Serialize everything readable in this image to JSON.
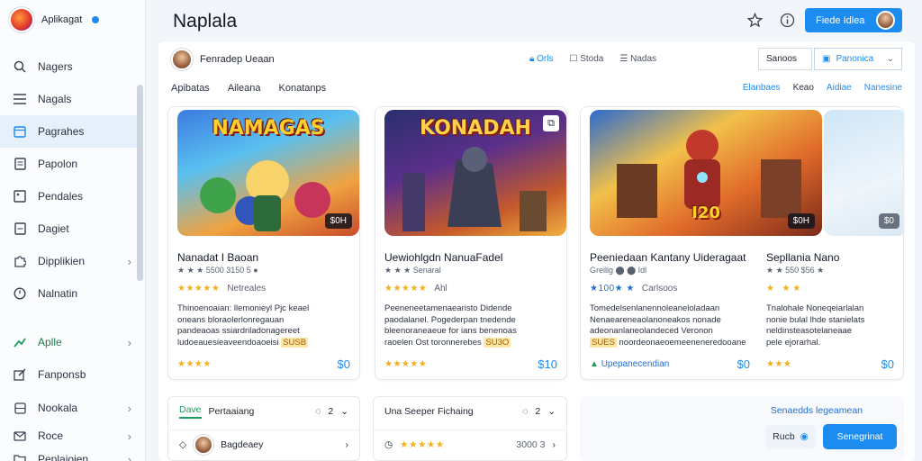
{
  "app": {
    "name": "Aplikagat",
    "title": "Naplala"
  },
  "sidebar": {
    "items": [
      {
        "label": "Nagers",
        "icon": "search-icon"
      },
      {
        "label": "Nagals",
        "icon": "list-icon"
      },
      {
        "label": "Pagrahes",
        "icon": "calendar-icon",
        "active": true
      },
      {
        "label": "Papolon",
        "icon": "document-icon"
      },
      {
        "label": "Pendales",
        "icon": "image-icon"
      },
      {
        "label": "Dagiet",
        "icon": "file-icon"
      },
      {
        "label": "Dipplikien",
        "icon": "puzzle-icon",
        "chevron": true
      },
      {
        "label": "Nalnatin",
        "icon": "clock-icon"
      },
      {
        "label": "Aplle",
        "icon": "trend-icon",
        "chevron": true,
        "accent": true
      },
      {
        "label": "Fanponsb",
        "icon": "edit-icon"
      },
      {
        "label": "Nookala",
        "icon": "grid-icon",
        "chevron": true
      },
      {
        "label": "Roce",
        "icon": "mail-icon",
        "chevron": true
      },
      {
        "label": "Peplaiojen",
        "icon": "folder-icon",
        "chevron": true
      }
    ]
  },
  "header": {
    "action_label": "Fiede Idlea"
  },
  "user": {
    "name": "Fenradep Ueaan"
  },
  "top_tabs": [
    "Orls",
    "Stoda",
    "Nadas"
  ],
  "selects": {
    "left": "Sanoos",
    "right": "Panonica"
  },
  "filters": [
    "Apibatas",
    "Aileana",
    "Konatanps"
  ],
  "sort_options": [
    "Elanbaes",
    "Keao",
    "Aidiae",
    "Nanesine"
  ],
  "cards": [
    {
      "thumb_title": "NAMAGAS",
      "price_chip": "$0H",
      "title": "Nanadat I Baoan",
      "meta": "★ ★ ★ 5500 3150 5 ●",
      "rating_note": "Netreales",
      "desc_lines": [
        "Thinoenoaian: llemonieyl Pjc keael",
        "oneans bloraolerlonregauan",
        "pandeaoas  ssiardriladonagereet",
        "ludoeauesieaveendoaoeisi"
      ],
      "desc_highlight": "SUSB",
      "foot_left": "",
      "price": "$0",
      "stars": "★★★★★",
      "foot_stars": "★★★★"
    },
    {
      "thumb_title": "KONADAH",
      "price_chip": "",
      "title": "Uewiohlgdn NanuaFadel",
      "meta": "★ ★ ★ Senaral",
      "rating_note": "Ahl",
      "desc_lines": [
        "Peeneneetamenaearisto Didende",
        "paodalanel. Pogederpan tnedende",
        "bleenoraneaeue  for ians benenoas",
        "raoelen Ost toronnerebes"
      ],
      "desc_highlight": "SU3O",
      "foot_left": "",
      "price": "$10",
      "stars": "★★★★★",
      "foot_stars": "★★★★★"
    },
    {
      "thumb_title": "I20",
      "price_chip": "$0H",
      "title": "Peeniedaan Kantany Uideragaat",
      "meta": "Greilig ⬤ ⬤ Idl",
      "rating_note": "Carlsoos",
      "desc_lines": [
        "Tomedelsenlanennoleaneloladaan",
        "Nenaeareneaolanoneakos nonade",
        "adeonanlaneolandeced Veronon",
        "noordeonaeoemeeneneredooane"
      ],
      "desc_highlight": "SUES",
      "foot_left": "Upepanecendian",
      "price": "$0",
      "stars": "★100★ ★",
      "foot_stars": ""
    },
    {
      "thumb_title": "",
      "price_chip": "$0",
      "title": "Sepllania Nano",
      "meta": "★ ★ 550 $56 ★",
      "rating_note": "★ ★",
      "desc_lines": [
        "Tnalohale Noneqeiarlalan",
        "nonie bulal lhde stanielats",
        "neldinsteasotelaneaae",
        "pele ejorarhal."
      ],
      "desc_highlight": "",
      "foot_left": "",
      "price": "$0",
      "stars": "★",
      "foot_stars": "★★★"
    }
  ],
  "bottom": {
    "panel1": {
      "tab_active": "Dave",
      "tab_label": "Pertaaiang",
      "count": "2",
      "row_label": "Bagdeaey"
    },
    "panel2": {
      "title": "Una Seeper Fichaing",
      "count": "2",
      "row_value": "3000 3"
    },
    "panel3": {
      "link": "Senaedds legeamean",
      "ghost_label": "Rucb",
      "primary_label": "Senegrinat"
    }
  },
  "colors": {
    "accent": "#1d8cf0",
    "star": "#f2b01e",
    "highlight_bg": "#fde7a6"
  }
}
